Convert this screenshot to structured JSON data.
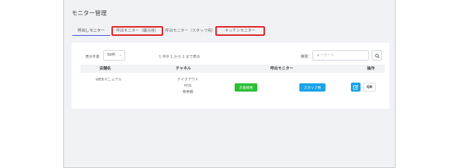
{
  "page_title": "モニター管理",
  "tabs": [
    {
      "label": "呼出しモニター",
      "active": true,
      "highlighted": false
    },
    {
      "label": "呼出モニター（顧示用）",
      "active": false,
      "highlighted": true
    },
    {
      "label": "呼出モニター（スタッフ用）",
      "active": false,
      "highlighted": false
    },
    {
      "label": "キッチンモニター",
      "active": false,
      "highlighted": true
    }
  ],
  "controls": {
    "display_count_label": "表示件数",
    "display_count_value": "50件",
    "record_count": "1 件中 1 から 1 まで表示",
    "search_label": "検索：",
    "search_placeholder": "キーワード"
  },
  "table": {
    "headers": [
      "店舗名",
      "チャネル",
      "呼出モニター",
      "操作"
    ],
    "rows": [
      {
        "store": "WEBマニュアル",
        "channels": [
          "テイクアウト",
          "POS",
          "券売機"
        ],
        "customer_button": "お客様用",
        "staff_button": "スタッフ用",
        "qr_label": "QR"
      }
    ]
  },
  "colors": {
    "tab_highlight": "#e01818",
    "customer_button": "#2bbf33",
    "staff_button": "#1aa3e8",
    "active_tab_underline": "#3b4bd6"
  }
}
